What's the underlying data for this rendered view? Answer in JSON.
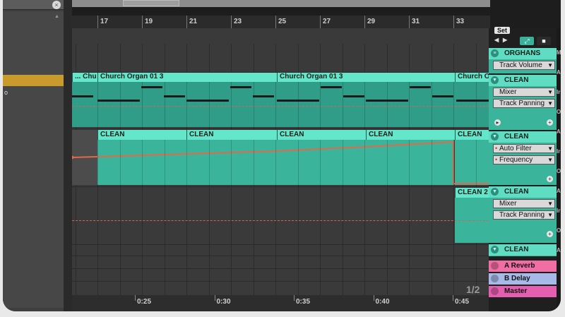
{
  "browser": {
    "close_glyph": "×",
    "scroll_glyph": "▲",
    "fragment": "o"
  },
  "ruler": {
    "bars": [
      "17",
      "19",
      "21",
      "23",
      "25",
      "27",
      "29",
      "31",
      "33"
    ]
  },
  "timeline": {
    "labels": [
      "0:25",
      "0:30",
      "0:35",
      "0:40",
      "0:45"
    ],
    "page": "1/2"
  },
  "clips": {
    "organ_fragment": "... Chu",
    "organ_a": "Church Organ 01 3",
    "organ_b": "Church Organ 01 3",
    "organ_c": "Church O",
    "clean_1": "CLEAN",
    "clean_2": "CLEAN",
    "clean_3": "CLEAN",
    "clean_4": "CLEAN",
    "clean_5": "CLEAN",
    "clean_alt": "CLEAN 2"
  },
  "panel": {
    "set_label": "Set",
    "nav_left": "◀",
    "nav_right": "▶",
    "tracks": {
      "organs": {
        "name": "ORGHANS",
        "device": "Track Volume"
      },
      "clean_a": {
        "name": "CLEAN",
        "device": "Mixer",
        "param": "Track Panning"
      },
      "clean_b": {
        "name": "CLEAN",
        "device": "Auto Filter",
        "param": "Frequency"
      },
      "clean_c": {
        "name": "CLEAN",
        "device": "Mixer",
        "param": "Track Panning"
      },
      "clean_d": {
        "name": "CLEAN"
      }
    },
    "returns": [
      {
        "name": "A Reverb",
        "color": "#f06ea3"
      },
      {
        "name": "B Delay",
        "color": "#a7b9e6"
      },
      {
        "name": "Master",
        "color": "#e45fb0"
      }
    ],
    "right_letters": [
      "M",
      "A",
      "Ir",
      "O",
      "A",
      "Ir",
      "O",
      "A",
      "Ir",
      "O",
      "A"
    ]
  },
  "colors": {
    "clip": "#3bb49c",
    "clip_header": "#64e6cb",
    "automation": "#e06a4a"
  }
}
